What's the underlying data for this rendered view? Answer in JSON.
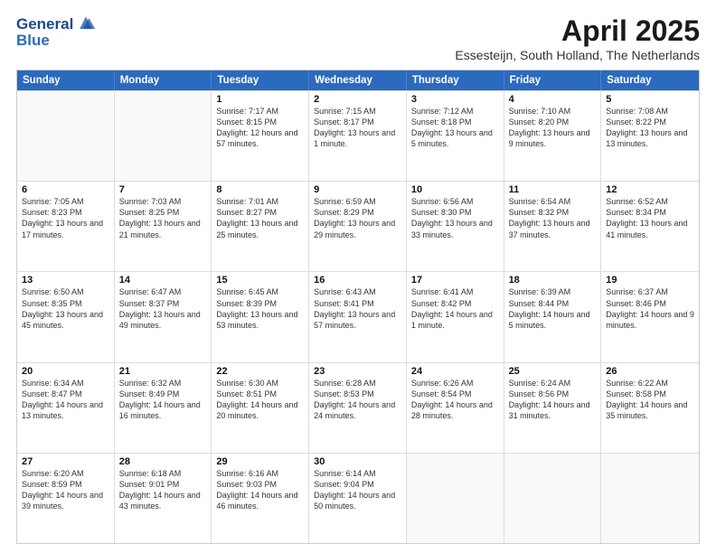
{
  "logo": {
    "line1": "General",
    "line2": "Blue"
  },
  "title": "April 2025",
  "subtitle": "Essesteijn, South Holland, The Netherlands",
  "header_days": [
    "Sunday",
    "Monday",
    "Tuesday",
    "Wednesday",
    "Thursday",
    "Friday",
    "Saturday"
  ],
  "weeks": [
    [
      {
        "day": "",
        "empty": true
      },
      {
        "day": "",
        "empty": true
      },
      {
        "day": "1",
        "sunrise": "7:17 AM",
        "sunset": "8:15 PM",
        "daylight": "12 hours and 57 minutes."
      },
      {
        "day": "2",
        "sunrise": "7:15 AM",
        "sunset": "8:17 PM",
        "daylight": "13 hours and 1 minute."
      },
      {
        "day": "3",
        "sunrise": "7:12 AM",
        "sunset": "8:18 PM",
        "daylight": "13 hours and 5 minutes."
      },
      {
        "day": "4",
        "sunrise": "7:10 AM",
        "sunset": "8:20 PM",
        "daylight": "13 hours and 9 minutes."
      },
      {
        "day": "5",
        "sunrise": "7:08 AM",
        "sunset": "8:22 PM",
        "daylight": "13 hours and 13 minutes."
      }
    ],
    [
      {
        "day": "6",
        "sunrise": "7:05 AM",
        "sunset": "8:23 PM",
        "daylight": "13 hours and 17 minutes."
      },
      {
        "day": "7",
        "sunrise": "7:03 AM",
        "sunset": "8:25 PM",
        "daylight": "13 hours and 21 minutes."
      },
      {
        "day": "8",
        "sunrise": "7:01 AM",
        "sunset": "8:27 PM",
        "daylight": "13 hours and 25 minutes."
      },
      {
        "day": "9",
        "sunrise": "6:59 AM",
        "sunset": "8:29 PM",
        "daylight": "13 hours and 29 minutes."
      },
      {
        "day": "10",
        "sunrise": "6:56 AM",
        "sunset": "8:30 PM",
        "daylight": "13 hours and 33 minutes."
      },
      {
        "day": "11",
        "sunrise": "6:54 AM",
        "sunset": "8:32 PM",
        "daylight": "13 hours and 37 minutes."
      },
      {
        "day": "12",
        "sunrise": "6:52 AM",
        "sunset": "8:34 PM",
        "daylight": "13 hours and 41 minutes."
      }
    ],
    [
      {
        "day": "13",
        "sunrise": "6:50 AM",
        "sunset": "8:35 PM",
        "daylight": "13 hours and 45 minutes."
      },
      {
        "day": "14",
        "sunrise": "6:47 AM",
        "sunset": "8:37 PM",
        "daylight": "13 hours and 49 minutes."
      },
      {
        "day": "15",
        "sunrise": "6:45 AM",
        "sunset": "8:39 PM",
        "daylight": "13 hours and 53 minutes."
      },
      {
        "day": "16",
        "sunrise": "6:43 AM",
        "sunset": "8:41 PM",
        "daylight": "13 hours and 57 minutes."
      },
      {
        "day": "17",
        "sunrise": "6:41 AM",
        "sunset": "8:42 PM",
        "daylight": "14 hours and 1 minute."
      },
      {
        "day": "18",
        "sunrise": "6:39 AM",
        "sunset": "8:44 PM",
        "daylight": "14 hours and 5 minutes."
      },
      {
        "day": "19",
        "sunrise": "6:37 AM",
        "sunset": "8:46 PM",
        "daylight": "14 hours and 9 minutes."
      }
    ],
    [
      {
        "day": "20",
        "sunrise": "6:34 AM",
        "sunset": "8:47 PM",
        "daylight": "14 hours and 13 minutes."
      },
      {
        "day": "21",
        "sunrise": "6:32 AM",
        "sunset": "8:49 PM",
        "daylight": "14 hours and 16 minutes."
      },
      {
        "day": "22",
        "sunrise": "6:30 AM",
        "sunset": "8:51 PM",
        "daylight": "14 hours and 20 minutes."
      },
      {
        "day": "23",
        "sunrise": "6:28 AM",
        "sunset": "8:53 PM",
        "daylight": "14 hours and 24 minutes."
      },
      {
        "day": "24",
        "sunrise": "6:26 AM",
        "sunset": "8:54 PM",
        "daylight": "14 hours and 28 minutes."
      },
      {
        "day": "25",
        "sunrise": "6:24 AM",
        "sunset": "8:56 PM",
        "daylight": "14 hours and 31 minutes."
      },
      {
        "day": "26",
        "sunrise": "6:22 AM",
        "sunset": "8:58 PM",
        "daylight": "14 hours and 35 minutes."
      }
    ],
    [
      {
        "day": "27",
        "sunrise": "6:20 AM",
        "sunset": "8:59 PM",
        "daylight": "14 hours and 39 minutes."
      },
      {
        "day": "28",
        "sunrise": "6:18 AM",
        "sunset": "9:01 PM",
        "daylight": "14 hours and 43 minutes."
      },
      {
        "day": "29",
        "sunrise": "6:16 AM",
        "sunset": "9:03 PM",
        "daylight": "14 hours and 46 minutes."
      },
      {
        "day": "30",
        "sunrise": "6:14 AM",
        "sunset": "9:04 PM",
        "daylight": "14 hours and 50 minutes."
      },
      {
        "day": "",
        "empty": true
      },
      {
        "day": "",
        "empty": true
      },
      {
        "day": "",
        "empty": true
      }
    ]
  ],
  "sunrise_label": "Sunrise:",
  "sunset_label": "Sunset:",
  "daylight_label": "Daylight:"
}
